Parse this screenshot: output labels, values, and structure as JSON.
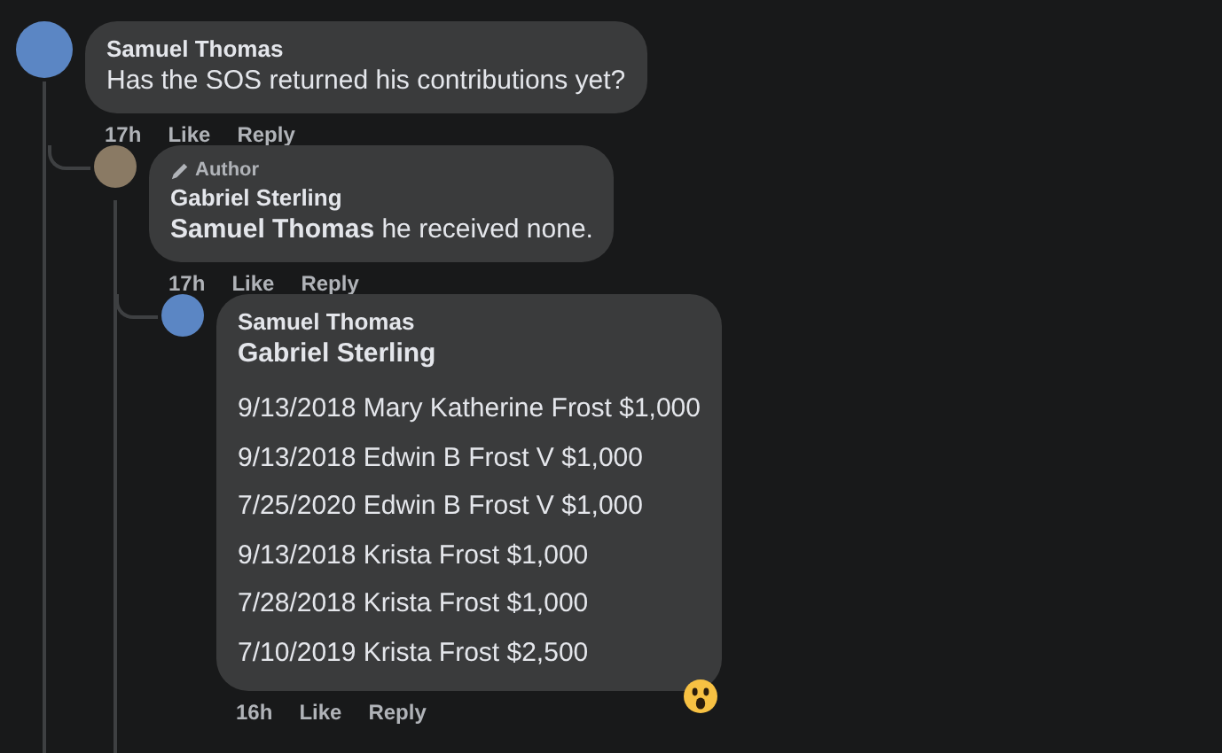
{
  "comments": [
    {
      "author": "Samuel Thomas",
      "text": "Has the SOS returned his contributions yet?",
      "time": "17h",
      "actions": [
        "Like",
        "Reply"
      ],
      "children": [
        {
          "badge": "Author",
          "author": "Gabriel Sterling",
          "mention": "Samuel Thomas",
          "text": "he received none.",
          "time": "17h",
          "actions": [
            "Like",
            "Reply"
          ],
          "children": [
            {
              "author": "Samuel Thomas",
              "mention": "Gabriel Sterling",
              "lines": [
                "9/13/2018 Mary Katherine Frost $1,000",
                "9/13/2018 Edwin B Frost V $1,000",
                "7/25/2020 Edwin B Frost V $1,000",
                "9/13/2018 Krista Frost $1,000",
                "7/28/2018 Krista Frost $1,000",
                "7/10/2019 Krista Frost $2,500"
              ],
              "time": "16h",
              "actions": [
                "Like",
                "Reply"
              ],
              "reaction": {
                "kind": "wow"
              }
            }
          ]
        }
      ]
    }
  ]
}
